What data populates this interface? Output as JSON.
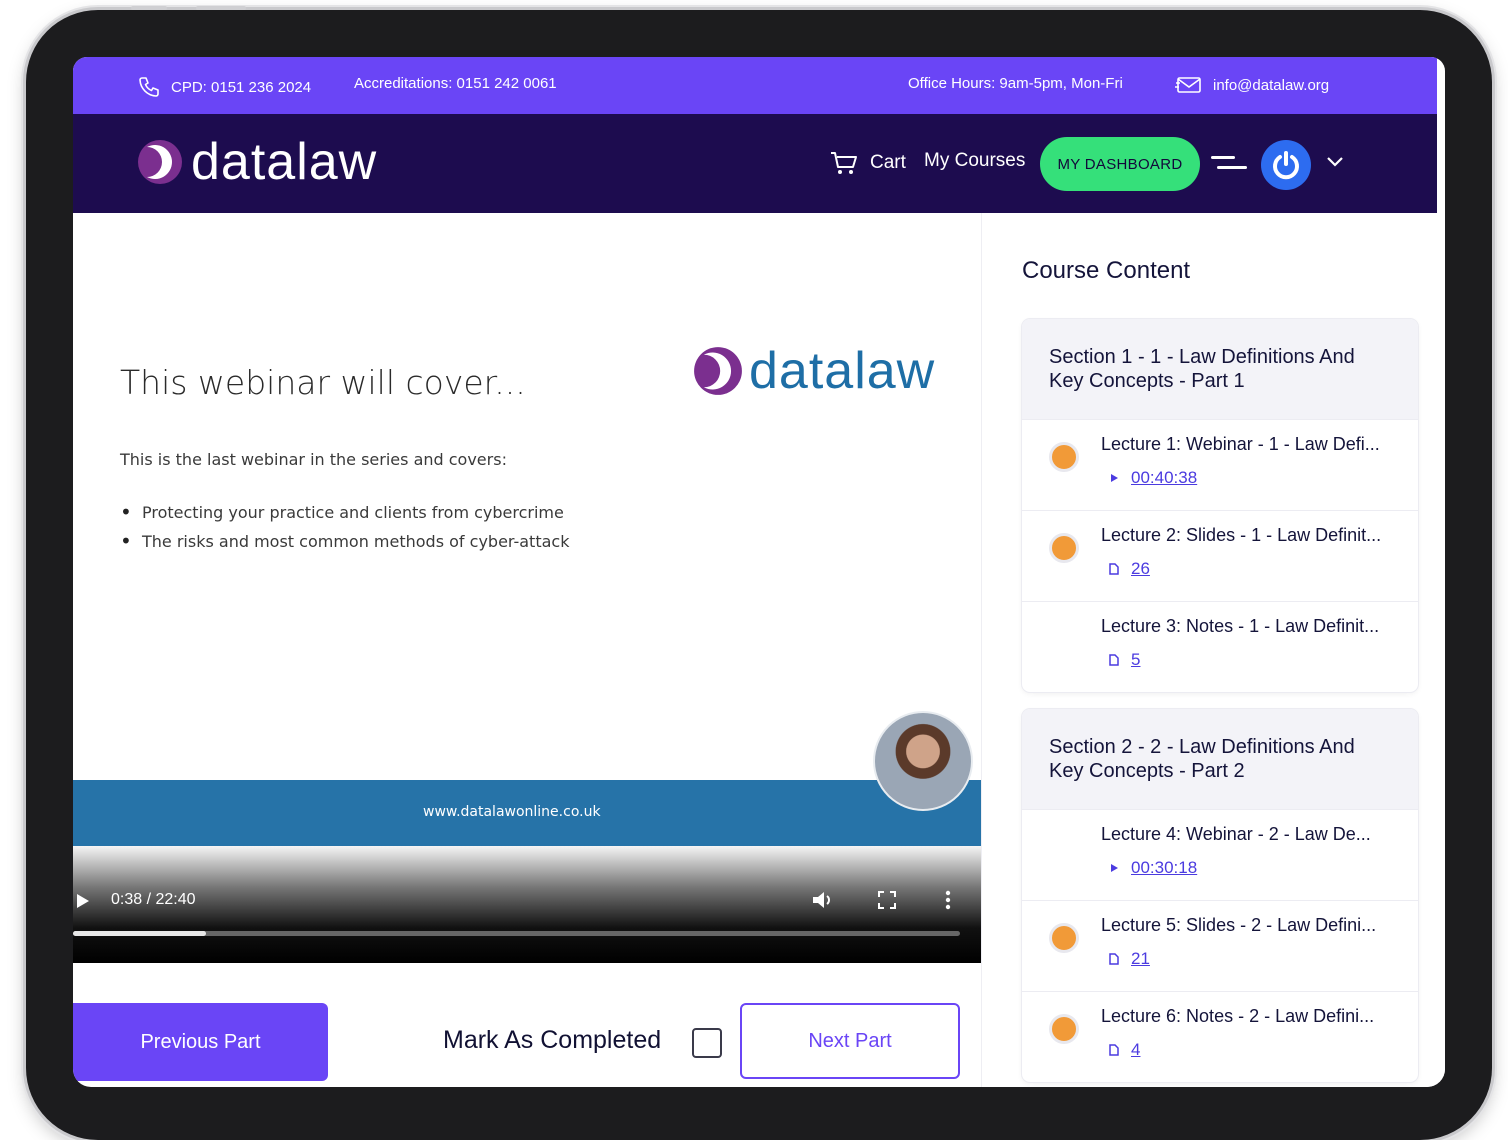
{
  "topbar": {
    "cpd": "CPD: 0151 236 2024",
    "accreditations": "Accreditations: 0151 242 0061",
    "office_hours": "Office Hours: 9am-5pm, Mon-Fri",
    "email": "info@datalaw.org"
  },
  "header": {
    "logo_text": "datalaw",
    "cart_label": "Cart",
    "my_courses_label": "My Courses",
    "dashboard_label": "MY DASHBOARD"
  },
  "video": {
    "slide_heading": "This webinar will cover...",
    "slide_logo_text": "datalaw",
    "slide_intro": "This is the last webinar in the series and covers:",
    "slide_bullets": [
      "Protecting your practice and clients from cybercrime",
      "The risks and most common methods of cyber-attack"
    ],
    "slide_footer_url": "www.datalawonline.co.uk",
    "time_display": "0:38 / 22:40",
    "progress_fraction": 0.15
  },
  "actions": {
    "previous_label": "Previous Part",
    "mark_completed_label": "Mark As Completed",
    "mark_completed_checked": false,
    "next_label": "Next Part"
  },
  "sidebar": {
    "title": "Course Content",
    "sections": [
      {
        "title": "Section 1 - 1 - Law Definitions And Key Concepts - Part 1",
        "lectures": [
          {
            "title": "Lecture 1: Webinar - 1 - Law Defi...",
            "meta": "00:40:38",
            "kind": "video",
            "status": "in-progress"
          },
          {
            "title": "Lecture 2: Slides - 1 - Law Definit...",
            "meta": "26",
            "kind": "document",
            "status": "in-progress"
          },
          {
            "title": "Lecture 3: Notes - 1 - Law Definit...",
            "meta": "5",
            "kind": "document",
            "status": "none"
          }
        ]
      },
      {
        "title": "Section 2 - 2 - Law Definitions And Key Concepts - Part 2",
        "lectures": [
          {
            "title": "Lecture 4: Webinar - 2 - Law De...",
            "meta": "00:30:18",
            "kind": "video",
            "status": "none"
          },
          {
            "title": "Lecture 5: Slides - 2 - Law Defini...",
            "meta": "21",
            "kind": "document",
            "status": "in-progress"
          },
          {
            "title": "Lecture 6: Notes - 2 - Law Defini...",
            "meta": "4",
            "kind": "document",
            "status": "in-progress"
          }
        ]
      }
    ]
  },
  "colors": {
    "brand_purple": "#6a45f6",
    "header_navy": "#1d0c4f",
    "dashboard_green": "#35e07a",
    "progress_orange": "#f19a38",
    "slide_blue": "#2673a8"
  }
}
